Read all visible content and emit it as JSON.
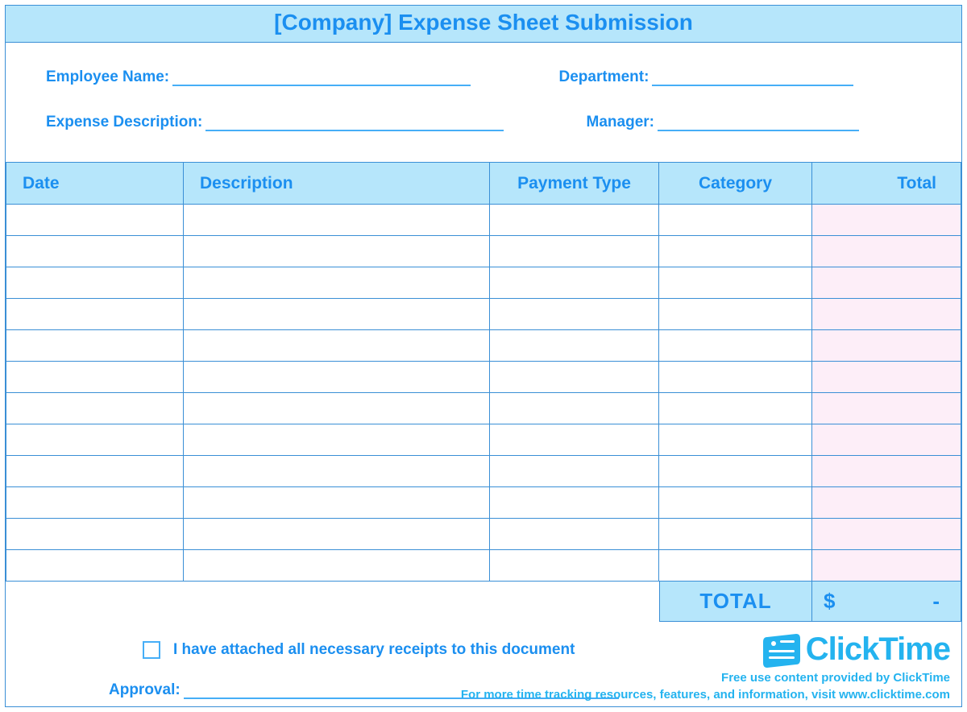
{
  "title": "[Company] Expense Sheet Submission",
  "fields": {
    "employee_name": {
      "label": "Employee Name:",
      "value": ""
    },
    "department": {
      "label": "Department:",
      "value": ""
    },
    "expense_desc": {
      "label": "Expense Description:",
      "value": ""
    },
    "manager": {
      "label": "Manager:",
      "value": ""
    }
  },
  "columns": {
    "date": "Date",
    "description": "Description",
    "payment": "Payment Type",
    "category": "Category",
    "total": "Total"
  },
  "rows": [
    {
      "date": "",
      "description": "",
      "payment": "",
      "category": "",
      "total": ""
    },
    {
      "date": "",
      "description": "",
      "payment": "",
      "category": "",
      "total": ""
    },
    {
      "date": "",
      "description": "",
      "payment": "",
      "category": "",
      "total": ""
    },
    {
      "date": "",
      "description": "",
      "payment": "",
      "category": "",
      "total": ""
    },
    {
      "date": "",
      "description": "",
      "payment": "",
      "category": "",
      "total": ""
    },
    {
      "date": "",
      "description": "",
      "payment": "",
      "category": "",
      "total": ""
    },
    {
      "date": "",
      "description": "",
      "payment": "",
      "category": "",
      "total": ""
    },
    {
      "date": "",
      "description": "",
      "payment": "",
      "category": "",
      "total": ""
    },
    {
      "date": "",
      "description": "",
      "payment": "",
      "category": "",
      "total": ""
    },
    {
      "date": "",
      "description": "",
      "payment": "",
      "category": "",
      "total": ""
    },
    {
      "date": "",
      "description": "",
      "payment": "",
      "category": "",
      "total": ""
    },
    {
      "date": "",
      "description": "",
      "payment": "",
      "category": "",
      "total": ""
    }
  ],
  "grand_total": {
    "label": "TOTAL",
    "currency": "$",
    "value": "-"
  },
  "receipts_confirmation": "I have attached all necessary receipts to this document",
  "approval_label": "Approval:",
  "brand": {
    "name": "ClickTime"
  },
  "footer": {
    "line1": "Free use content provided by ClickTime",
    "line2": "For more time tracking resources, features, and information, visit www.clicktime.com"
  }
}
